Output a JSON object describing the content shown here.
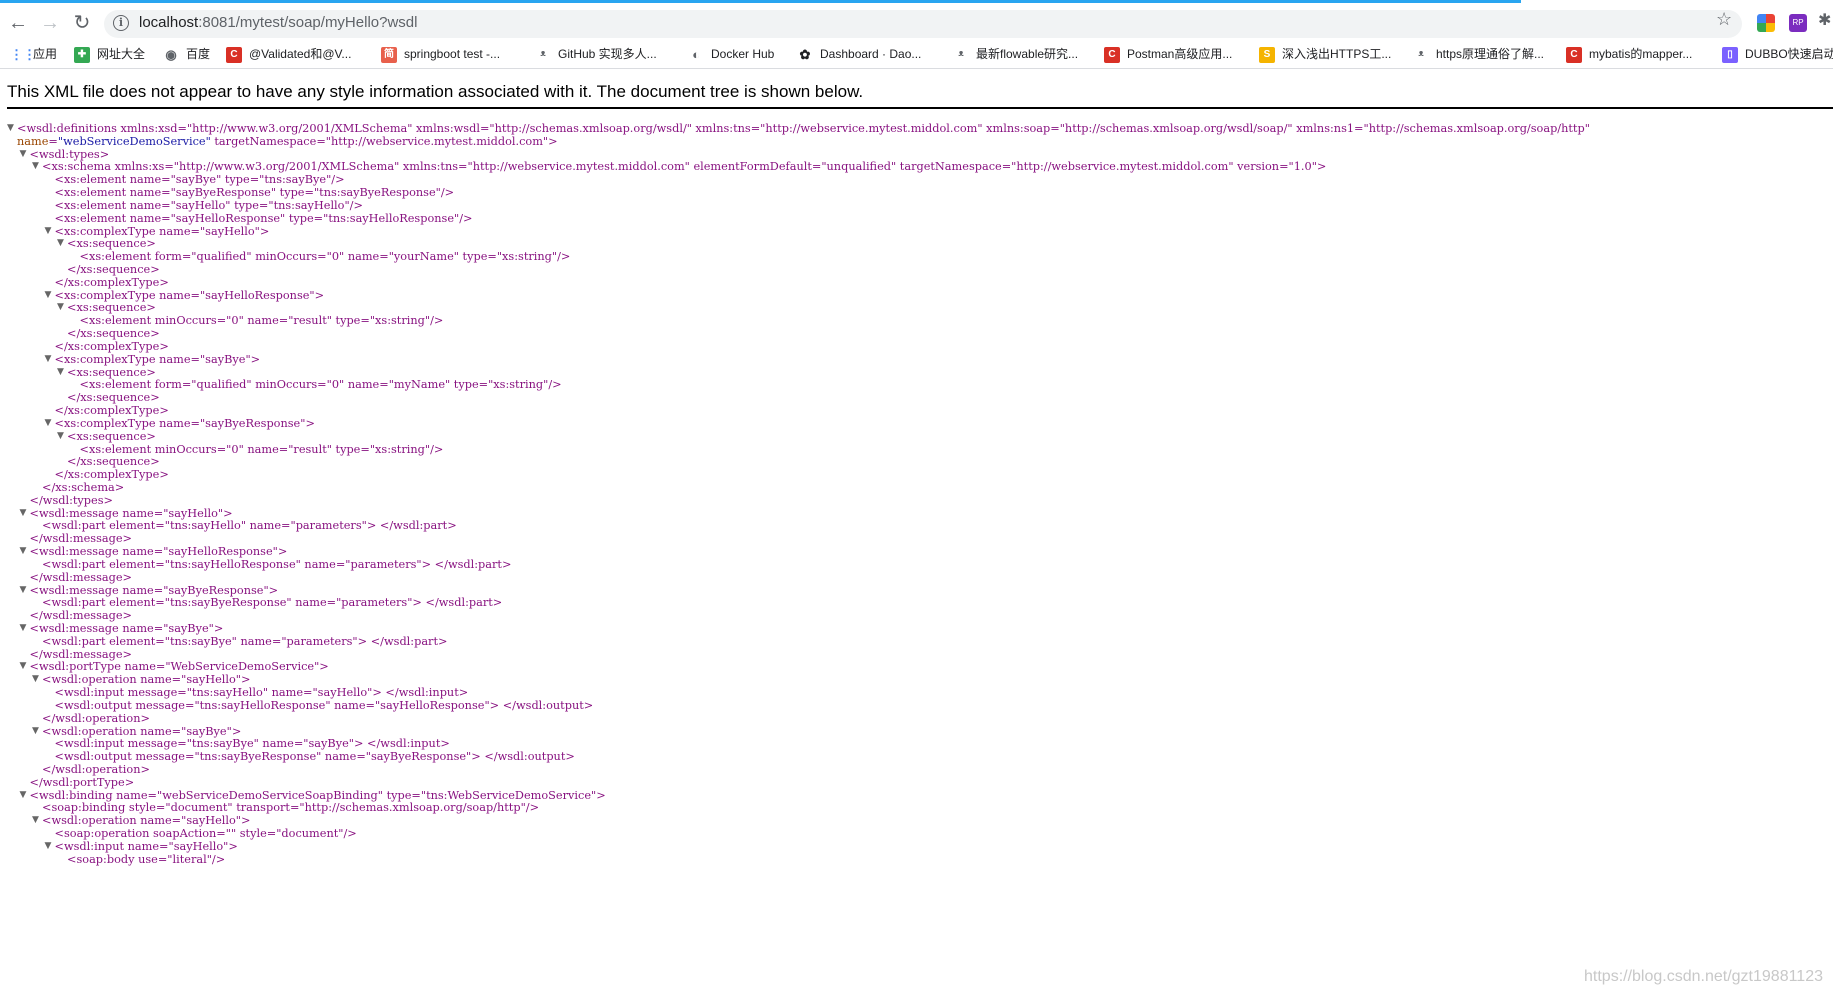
{
  "browser": {
    "url_host": "localhost",
    "url_rest": ":8081/mytest/soap/myHello?wsdl",
    "load_progress": 0.83
  },
  "bookmarks": [
    {
      "label": "应用",
      "icon": "apps-grid-icon",
      "color": "#4285f4"
    },
    {
      "label": "网址大全",
      "icon": "puzzle-icon",
      "color": "#34a853"
    },
    {
      "label": "百度",
      "icon": "globe-icon",
      "color": "#5f6368"
    },
    {
      "label": "@Validated和@V...",
      "icon": "csdn-icon",
      "color": "#d93025"
    },
    {
      "label": "springboot test -...",
      "icon": "jianshu-icon",
      "color": "#e8604c"
    },
    {
      "label": "GitHub 实现多人...",
      "icon": "bird-icon",
      "color": "#5f6368"
    },
    {
      "label": "Docker Hub",
      "icon": "docker-icon",
      "color": "#5f6368"
    },
    {
      "label": "Dashboard · Dao...",
      "icon": "gear-icon",
      "color": "#202124"
    },
    {
      "label": "最新flowable研究...",
      "icon": "bird-icon",
      "color": "#5f6368"
    },
    {
      "label": "Postman高级应用...",
      "icon": "csdn-icon",
      "color": "#d93025"
    },
    {
      "label": "深入浅出HTTPS工...",
      "icon": "sogou-icon",
      "color": "#f5b400"
    },
    {
      "label": "https原理通俗了解...",
      "icon": "bird-icon",
      "color": "#5f6368"
    },
    {
      "label": "mybatis的mapper...",
      "icon": "csdn-icon",
      "color": "#d93025"
    },
    {
      "label": "DUBBO快速启动",
      "icon": "doc-icon",
      "color": "#7b61ff"
    }
  ],
  "notice": "This XML file does not appear to have any style information associated with it. The document tree is shown below.",
  "xml_lines": [
    {
      "t": "▼",
      "c": "<wsdl:definitions xmlns:xsd=\"http://www.w3.org/2001/XMLSchema\" xmlns:wsdl=\"http://schemas.xmlsoap.org/wsdl/\" xmlns:tns=\"http://webservice.mytest.middol.com\" xmlns:soap=\"http://schemas.xmlsoap.org/wsdl/soap/\" xmlns:ns1=\"http://schemas.xmlsoap.org/soap/http\""
    },
    {
      "t": "",
      "c": "name=\"webServiceDemoService\" targetNamespace=\"http://webservice.mytest.middol.com\">"
    },
    {
      "t": "▼",
      "c": "<wsdl:types>"
    },
    {
      "t": "▼",
      "c": "<xs:schema xmlns:xs=\"http://www.w3.org/2001/XMLSchema\" xmlns:tns=\"http://webservice.mytest.middol.com\" elementFormDefault=\"unqualified\" targetNamespace=\"http://webservice.mytest.middol.com\" version=\"1.0\">"
    },
    {
      "t": "",
      "c": "<xs:element name=\"sayBye\" type=\"tns:sayBye\"/>"
    },
    {
      "t": "",
      "c": "<xs:element name=\"sayByeResponse\" type=\"tns:sayByeResponse\"/>"
    },
    {
      "t": "",
      "c": "<xs:element name=\"sayHello\" type=\"tns:sayHello\"/>"
    },
    {
      "t": "",
      "c": "<xs:element name=\"sayHelloResponse\" type=\"tns:sayHelloResponse\"/>"
    },
    {
      "t": "▼",
      "c": "<xs:complexType name=\"sayHello\">"
    },
    {
      "t": "▼",
      "c": "<xs:sequence>"
    },
    {
      "t": "",
      "c": "<xs:element form=\"qualified\" minOccurs=\"0\" name=\"yourName\" type=\"xs:string\"/>"
    },
    {
      "t": "",
      "c": "</xs:sequence>"
    },
    {
      "t": "",
      "c": "</xs:complexType>"
    },
    {
      "t": "▼",
      "c": "<xs:complexType name=\"sayHelloResponse\">"
    },
    {
      "t": "▼",
      "c": "<xs:sequence>"
    },
    {
      "t": "",
      "c": "<xs:element minOccurs=\"0\" name=\"result\" type=\"xs:string\"/>"
    },
    {
      "t": "",
      "c": "</xs:sequence>"
    },
    {
      "t": "",
      "c": "</xs:complexType>"
    },
    {
      "t": "▼",
      "c": "<xs:complexType name=\"sayBye\">"
    },
    {
      "t": "▼",
      "c": "<xs:sequence>"
    },
    {
      "t": "",
      "c": "<xs:element form=\"qualified\" minOccurs=\"0\" name=\"myName\" type=\"xs:string\"/>"
    },
    {
      "t": "",
      "c": "</xs:sequence>"
    },
    {
      "t": "",
      "c": "</xs:complexType>"
    },
    {
      "t": "▼",
      "c": "<xs:complexType name=\"sayByeResponse\">"
    },
    {
      "t": "▼",
      "c": "<xs:sequence>"
    },
    {
      "t": "",
      "c": "<xs:element minOccurs=\"0\" name=\"result\" type=\"xs:string\"/>"
    },
    {
      "t": "",
      "c": "</xs:sequence>"
    },
    {
      "t": "",
      "c": "</xs:complexType>"
    },
    {
      "t": "",
      "c": "</xs:schema>"
    },
    {
      "t": "",
      "c": "</wsdl:types>"
    },
    {
      "t": "▼",
      "c": "<wsdl:message name=\"sayHello\">"
    },
    {
      "t": "",
      "c": "<wsdl:part element=\"tns:sayHello\" name=\"parameters\"> </wsdl:part>"
    },
    {
      "t": "",
      "c": "</wsdl:message>"
    },
    {
      "t": "▼",
      "c": "<wsdl:message name=\"sayHelloResponse\">"
    },
    {
      "t": "",
      "c": "<wsdl:part element=\"tns:sayHelloResponse\" name=\"parameters\"> </wsdl:part>"
    },
    {
      "t": "",
      "c": "</wsdl:message>"
    },
    {
      "t": "▼",
      "c": "<wsdl:message name=\"sayByeResponse\">"
    },
    {
      "t": "",
      "c": "<wsdl:part element=\"tns:sayByeResponse\" name=\"parameters\"> </wsdl:part>"
    },
    {
      "t": "",
      "c": "</wsdl:message>"
    },
    {
      "t": "▼",
      "c": "<wsdl:message name=\"sayBye\">"
    },
    {
      "t": "",
      "c": "<wsdl:part element=\"tns:sayBye\" name=\"parameters\"> </wsdl:part>"
    },
    {
      "t": "",
      "c": "</wsdl:message>"
    },
    {
      "t": "▼",
      "c": "<wsdl:portType name=\"WebServiceDemoService\">"
    },
    {
      "t": "▼",
      "c": "<wsdl:operation name=\"sayHello\">"
    },
    {
      "t": "",
      "c": "<wsdl:input message=\"tns:sayHello\" name=\"sayHello\"> </wsdl:input>"
    },
    {
      "t": "",
      "c": "<wsdl:output message=\"tns:sayHelloResponse\" name=\"sayHelloResponse\"> </wsdl:output>"
    },
    {
      "t": "",
      "c": "</wsdl:operation>"
    },
    {
      "t": "▼",
      "c": "<wsdl:operation name=\"sayBye\">"
    },
    {
      "t": "",
      "c": "<wsdl:input message=\"tns:sayBye\" name=\"sayBye\"> </wsdl:input>"
    },
    {
      "t": "",
      "c": "<wsdl:output message=\"tns:sayByeResponse\" name=\"sayByeResponse\"> </wsdl:output>"
    },
    {
      "t": "",
      "c": "</wsdl:operation>"
    },
    {
      "t": "",
      "c": "</wsdl:portType>"
    },
    {
      "t": "▼",
      "c": "<wsdl:binding name=\"webServiceDemoServiceSoapBinding\" type=\"tns:WebServiceDemoService\">"
    },
    {
      "t": "",
      "c": "<soap:binding style=\"document\" transport=\"http://schemas.xmlsoap.org/soap/http\"/>"
    },
    {
      "t": "▼",
      "c": "<wsdl:operation name=\"sayHello\">"
    },
    {
      "t": "",
      "c": "<soap:operation soapAction=\"\" style=\"document\"/>"
    },
    {
      "t": "▼",
      "c": "<wsdl:input name=\"sayHello\">"
    },
    {
      "t": "",
      "c": "<soap:body use=\"literal\"/>"
    }
  ],
  "watermark": "https://blog.csdn.net/gzt19881123"
}
